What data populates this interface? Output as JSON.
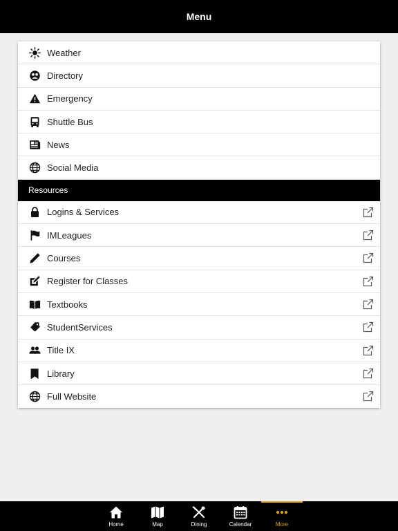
{
  "header": {
    "title": "Menu"
  },
  "menu": {
    "items": [
      {
        "label": "Weather",
        "icon": "sun-icon"
      },
      {
        "label": "Directory",
        "icon": "directory-icon"
      },
      {
        "label": "Emergency",
        "icon": "warning-icon"
      },
      {
        "label": "Shuttle Bus",
        "icon": "bus-icon"
      },
      {
        "label": "News",
        "icon": "newspaper-icon"
      },
      {
        "label": "Social Media",
        "icon": "globe-icon"
      }
    ]
  },
  "resources": {
    "header": "Resources",
    "items": [
      {
        "label": "Logins & Services",
        "icon": "lock-icon"
      },
      {
        "label": "IMLeagues",
        "icon": "flag-icon"
      },
      {
        "label": "Courses",
        "icon": "pencil-icon"
      },
      {
        "label": "Register for Classes",
        "icon": "edit-icon"
      },
      {
        "label": "Textbooks",
        "icon": "book-icon"
      },
      {
        "label": "StudentServices",
        "icon": "tag-icon"
      },
      {
        "label": "Title IX",
        "icon": "people-icon"
      },
      {
        "label": "Library",
        "icon": "bookmark-icon"
      },
      {
        "label": "Full Website",
        "icon": "globe-icon"
      }
    ],
    "external_icon": "external-link-icon"
  },
  "tabbar": {
    "tabs": [
      {
        "label": "Home",
        "icon": "home-icon"
      },
      {
        "label": "Map",
        "icon": "map-icon"
      },
      {
        "label": "Dining",
        "icon": "dining-icon"
      },
      {
        "label": "Calendar",
        "icon": "calendar-icon"
      },
      {
        "label": "More",
        "icon": "more-icon",
        "active": true
      }
    ],
    "active_color": "#e8a600"
  }
}
